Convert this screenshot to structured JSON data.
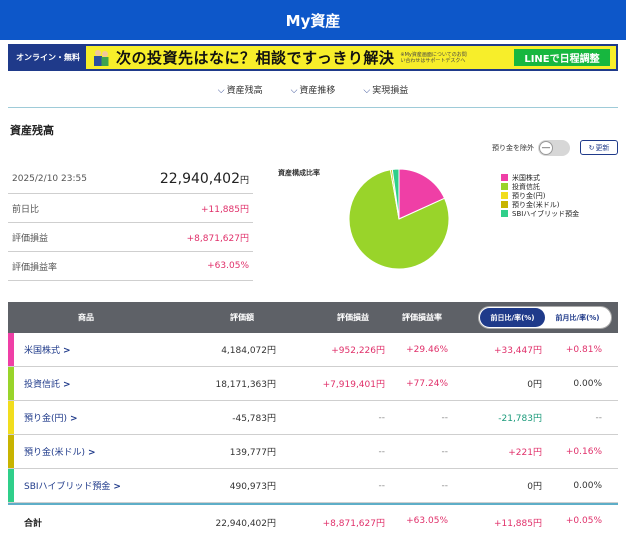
{
  "header": {
    "title": "My資産"
  },
  "banner": {
    "tag": "オンライン・無料",
    "catch": "次の投資先はなに？相談ですっきり解決",
    "small_text": "※My資産画面についてのお問い合わせはサポートデスクへ",
    "button": "LINEで日程調整"
  },
  "nav": {
    "items": [
      "資産残高",
      "資産推移",
      "実現損益"
    ]
  },
  "section": {
    "title": "資産残高"
  },
  "controls": {
    "exclude_deposits": "預り金を除外",
    "toggle_symbol": "—",
    "refresh": "更新"
  },
  "summary": {
    "datetime": "2025/2/10 23:55",
    "total_value": "22,940,402",
    "total_unit": "円",
    "rows": [
      {
        "label": "前日比",
        "value": "+11,885円"
      },
      {
        "label": "評価損益",
        "value": "+8,871,627円"
      },
      {
        "label": "評価損益率",
        "value": "+63.05%"
      }
    ]
  },
  "composition": {
    "title": "資産構成比率",
    "legend": [
      {
        "label": "米国株式",
        "color": "#ef3fa6"
      },
      {
        "label": "投資信託",
        "color": "#99d42a"
      },
      {
        "label": "預り金(円)",
        "color": "#f1dd1e"
      },
      {
        "label": "預り金(米ドル)",
        "color": "#c8b400"
      },
      {
        "label": "SBIハイブリッド預金",
        "color": "#2fcf8a"
      }
    ]
  },
  "chart_data": {
    "type": "pie",
    "categories": [
      "米国株式",
      "投資信託",
      "預り金(円)",
      "預り金(米ドル)",
      "SBIハイブリッド預金"
    ],
    "values": [
      4184072,
      18171363,
      0,
      139777,
      490973
    ],
    "colors": [
      "#ef3fa6",
      "#99d42a",
      "#f1dd1e",
      "#c8b400",
      "#2fcf8a"
    ],
    "title": "資産構成比率",
    "legend": "right"
  },
  "table": {
    "headers": {
      "product": "商品",
      "value": "評価額",
      "pl": "評価損益",
      "pl_rate": "評価損益率"
    },
    "switch": {
      "day": "前日比/率(%)",
      "month": "前月比/率(%)"
    },
    "rows": [
      {
        "name": "米国株式",
        "arrow": ">",
        "color": "#ef3fa6",
        "value": "4,184,072円",
        "pl": "+952,226円",
        "pl_rate": "+29.46%",
        "diff": "+33,447円",
        "diff_rate": "+0.81%"
      },
      {
        "name": "投資信託",
        "arrow": ">",
        "color": "#99d42a",
        "value": "18,171,363円",
        "pl": "+7,919,401円",
        "pl_rate": "+77.24%",
        "diff": "0円",
        "diff_rate": "0.00%"
      },
      {
        "name": "預り金(円)",
        "arrow": ">",
        "color": "#f1dd1e",
        "value": "-45,783円",
        "pl": "--",
        "pl_rate": "--",
        "diff": "-21,783円",
        "diff_rate": "--"
      },
      {
        "name": "預り金(米ドル)",
        "arrow": ">",
        "color": "#c8b400",
        "value": "139,777円",
        "pl": "--",
        "pl_rate": "--",
        "diff": "+221円",
        "diff_rate": "+0.16%"
      },
      {
        "name": "SBIハイブリッド預金",
        "arrow": ">",
        "color": "#2fcf8a",
        "value": "490,973円",
        "pl": "--",
        "pl_rate": "--",
        "diff": "0円",
        "diff_rate": "0.00%"
      }
    ],
    "total": {
      "name": "合計",
      "value": "22,940,402円",
      "pl": "+8,871,627円",
      "pl_rate": "+63.05%",
      "diff": "+11,885円",
      "diff_rate": "+0.05%"
    }
  }
}
